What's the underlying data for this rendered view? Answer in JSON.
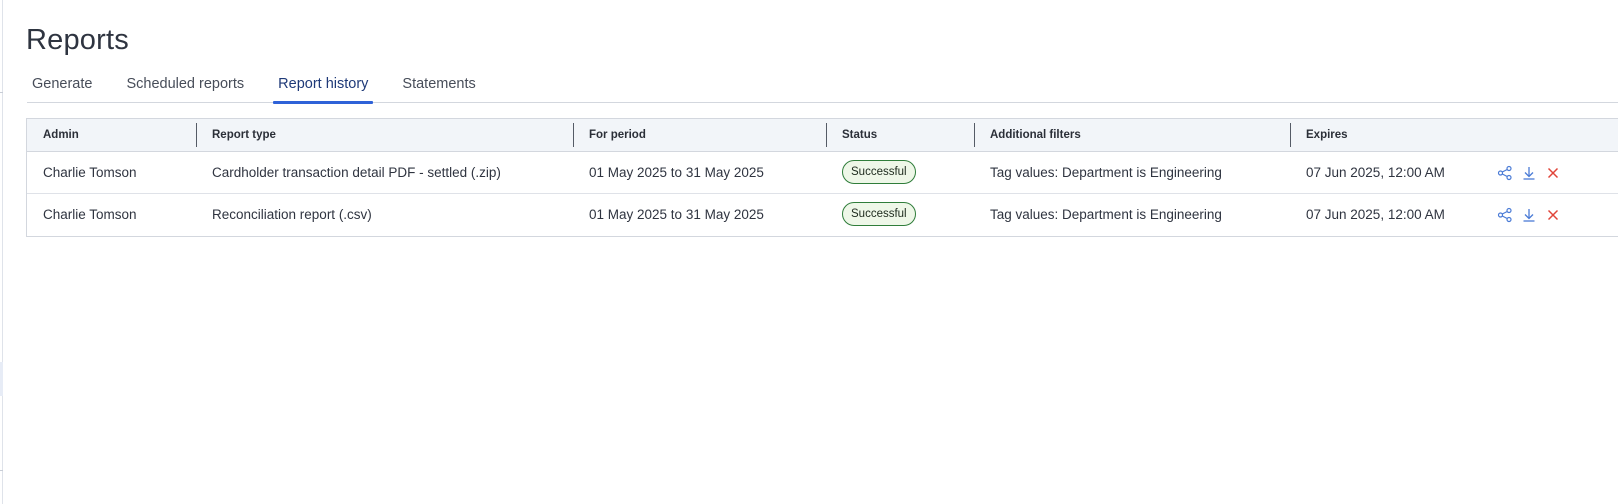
{
  "page": {
    "title": "Reports"
  },
  "tabs": [
    {
      "label": "Generate",
      "active": false
    },
    {
      "label": "Scheduled reports",
      "active": false
    },
    {
      "label": "Report history",
      "active": true
    },
    {
      "label": "Statements",
      "active": false
    }
  ],
  "table": {
    "columns": [
      "Admin",
      "Report type",
      "For period",
      "Status",
      "Additional filters",
      "Expires"
    ],
    "rows": [
      {
        "admin": "Charlie Tomson",
        "report_type": "Cardholder transaction detail PDF - settled (.zip)",
        "period": "01 May 2025 to 31 May 2025",
        "status": "Successful",
        "filters": "Tag values: Department is Engineering",
        "expires": "07 Jun 2025, 12:00 AM",
        "actions": [
          "share-icon",
          "download-icon",
          "delete-icon"
        ]
      },
      {
        "admin": "Charlie Tomson",
        "report_type": "Reconciliation report (.csv)",
        "period": "01 May 2025 to 31 May 2025",
        "status": "Successful",
        "filters": "Tag values: Department is Engineering",
        "expires": "07 Jun 2025, 12:00 AM",
        "actions": [
          "share-icon",
          "download-icon",
          "delete-icon"
        ]
      }
    ]
  },
  "colors": {
    "accent": "#2f62d8",
    "success_border": "#2f7d3a",
    "success_bg": "#eef7e8",
    "delete": "#e0453a",
    "icon_blue": "#4a7bd6"
  }
}
